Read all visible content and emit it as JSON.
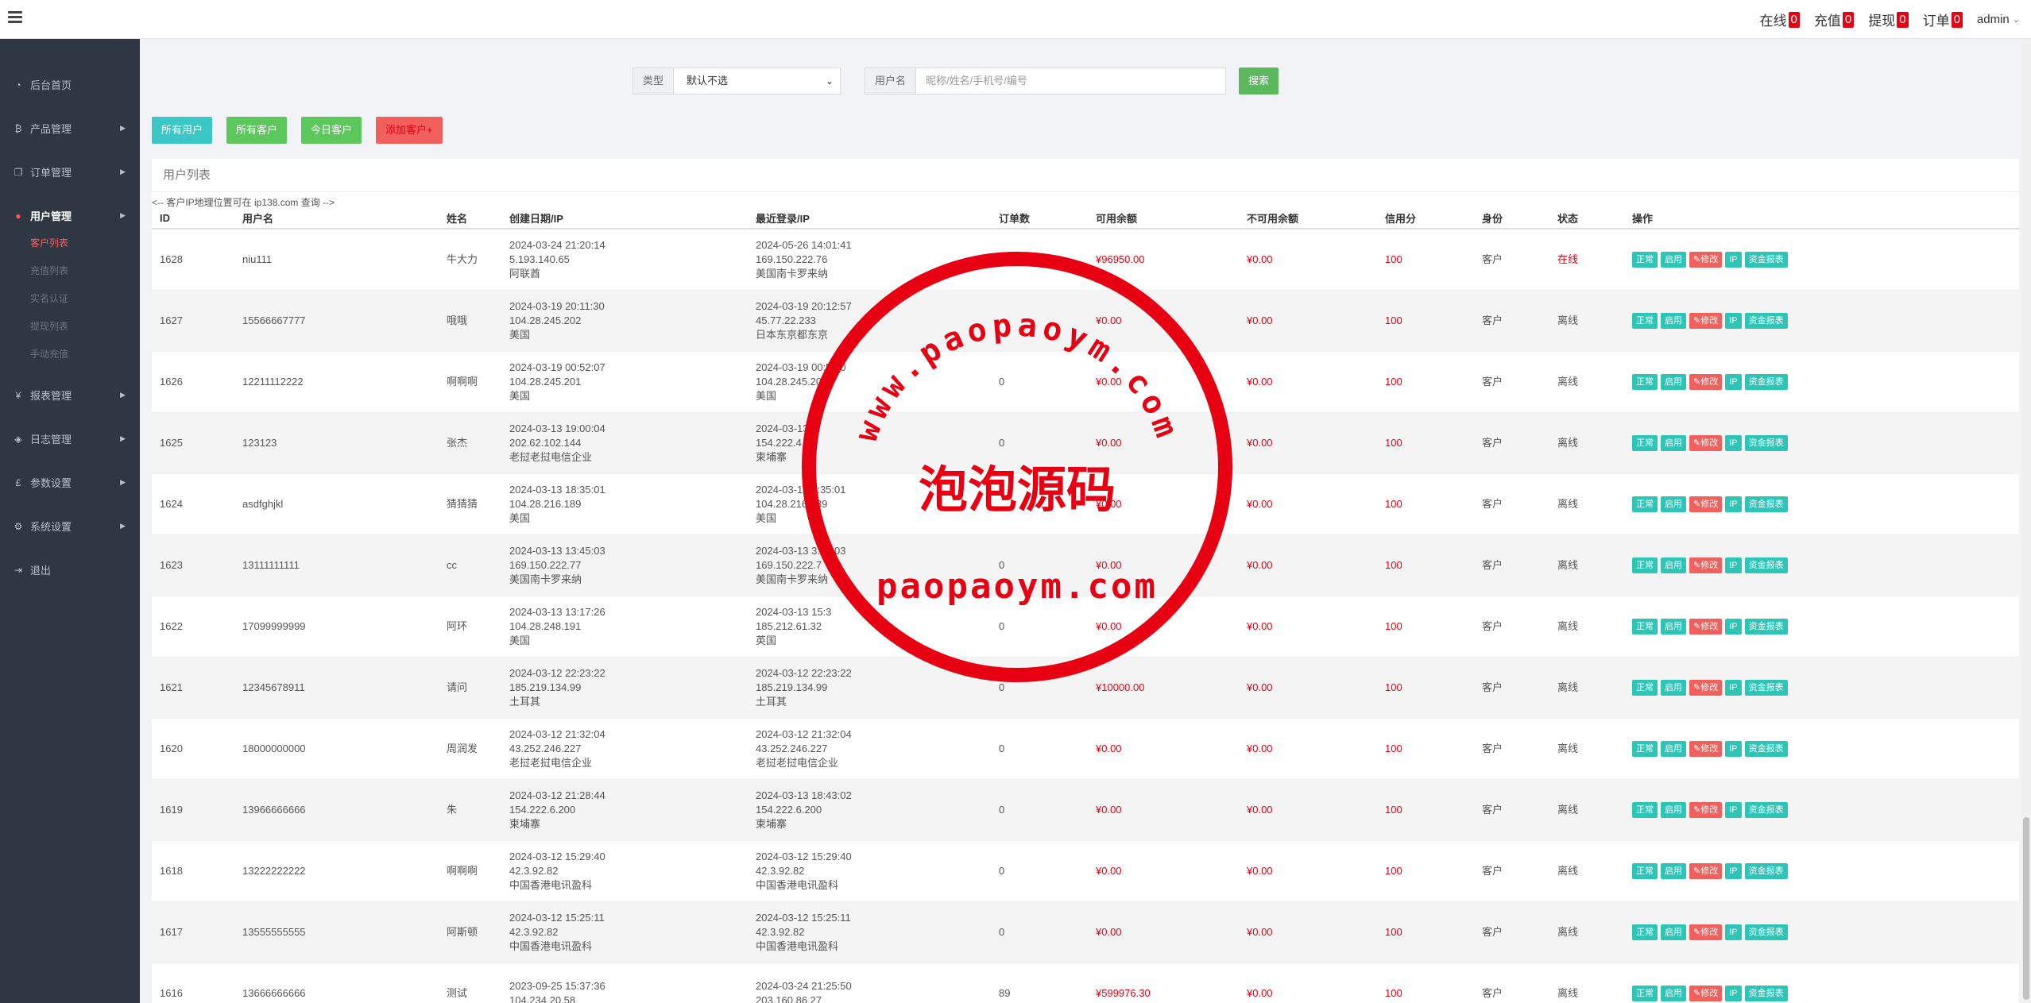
{
  "topbar": {
    "nav": [
      {
        "label": "在线",
        "badge": "0"
      },
      {
        "label": "充值",
        "badge": "0"
      },
      {
        "label": "提现",
        "badge": "0"
      },
      {
        "label": "订单",
        "badge": "0"
      }
    ],
    "user": "admin"
  },
  "sidebar": {
    "items": [
      {
        "label": "后台首页",
        "icon": "dashboard-icon"
      },
      {
        "label": "产品管理",
        "icon": "bitcoin-icon"
      },
      {
        "label": "订单管理",
        "icon": "copy-icon"
      },
      {
        "label": "用户管理",
        "icon": "user-icon"
      },
      {
        "label": "报表管理",
        "icon": "yen-icon"
      },
      {
        "label": "日志管理",
        "icon": "tag-icon"
      },
      {
        "label": "参数设置",
        "icon": "pound-icon"
      },
      {
        "label": "系统设置",
        "icon": "gears-icon"
      },
      {
        "label": "退出",
        "icon": "sign-out-icon"
      }
    ],
    "submenu": [
      "客户列表",
      "充值列表",
      "实名认证",
      "提现列表",
      "手动充值"
    ]
  },
  "search": {
    "type_label": "类型",
    "type_value": "默认不选",
    "user_label": "用户名",
    "user_placeholder": "昵称/姓名/手机号/编号",
    "search_btn": "搜索"
  },
  "filters": {
    "all_users": "所有用户",
    "all_customers": "所有客户",
    "today_customers": "今日客户",
    "add_customer": "添加客户+"
  },
  "panel": {
    "title": "用户列表",
    "comment": "<-- 客户IP地理位置可在 ip138.com 查询 -->"
  },
  "table": {
    "headers": [
      "ID",
      "用户名",
      "姓名",
      "创建日期/IP",
      "最近登录/IP",
      "订单数",
      "可用余额",
      "不可用余额",
      "信用分",
      "身份",
      "状态",
      "操作"
    ],
    "ops": [
      "正常",
      "启用",
      "✎修改",
      "IP",
      "资金报表"
    ],
    "rows": [
      {
        "id": "1628",
        "username": "niu111",
        "name": "牛大力",
        "created_date": "2024-03-24 21:20:14",
        "created_ip": "5.193.140.65",
        "created_loc": "阿联酋",
        "login_date": "2024-05-26 14:01:41",
        "login_ip": "169.150.222.76",
        "login_loc": "美国南卡罗来纳",
        "orders": "16",
        "balance": "¥96950.00",
        "frozen": "¥0.00",
        "credit": "100",
        "role": "客户",
        "status": "在线"
      },
      {
        "id": "1627",
        "username": "15566667777",
        "name": "哦哦",
        "created_date": "2024-03-19 20:11:30",
        "created_ip": "104.28.245.202",
        "created_loc": "美国",
        "login_date": "2024-03-19 20:12:57",
        "login_ip": "45.77.22.233",
        "login_loc": "日本东京都东京",
        "orders": "",
        "balance": "¥0.00",
        "frozen": "¥0.00",
        "credit": "100",
        "role": "客户",
        "status": "离线"
      },
      {
        "id": "1626",
        "username": "12211112222",
        "name": "啊啊啊",
        "created_date": "2024-03-19 00:52:07",
        "created_ip": "104.28.245.201",
        "created_loc": "美国",
        "login_date": "2024-03-19 00:52:0",
        "login_ip": "104.28.245.201",
        "login_loc": "美国",
        "orders": "0",
        "balance": "¥0.00",
        "frozen": "¥0.00",
        "credit": "100",
        "role": "客户",
        "status": "离线"
      },
      {
        "id": "1625",
        "username": "123123",
        "name": "张杰",
        "created_date": "2024-03-13 19:00:04",
        "created_ip": "202.62.102.144",
        "created_loc": "老挝老挝电信企业",
        "login_date": "2024-03-13",
        "login_ip": "154.222.4.1",
        "login_loc": "柬埔寨",
        "orders": "0",
        "balance": "¥0.00",
        "frozen": "¥0.00",
        "credit": "100",
        "role": "客户",
        "status": "离线"
      },
      {
        "id": "1624",
        "username": "asdfghjkl",
        "name": "猜猜猜",
        "created_date": "2024-03-13 18:35:01",
        "created_ip": "104.28.216.189",
        "created_loc": "美国",
        "login_date": "2024-03-1  18:35:01",
        "login_ip": "104.28.216.189",
        "login_loc": "美国",
        "orders": "",
        "balance": "¥0.00",
        "frozen": "¥0.00",
        "credit": "100",
        "role": "客户",
        "status": "离线"
      },
      {
        "id": "1623",
        "username": "13111111111",
        "name": "cc",
        "created_date": "2024-03-13 13:45:03",
        "created_ip": "169.150.222.77",
        "created_loc": "美国南卡罗来纳",
        "login_date": "2024-03-13  3:45:03",
        "login_ip": "169.150.222.7",
        "login_loc": "美国南卡罗来纳",
        "orders": "0",
        "balance": "¥0.00",
        "frozen": "¥0.00",
        "credit": "100",
        "role": "客户",
        "status": "离线"
      },
      {
        "id": "1622",
        "username": "17099999999",
        "name": "阿环",
        "created_date": "2024-03-13 13:17:26",
        "created_ip": "104.28.248.191",
        "created_loc": "美国",
        "login_date": "2024-03-13 15:3",
        "login_ip": "185.212.61.32",
        "login_loc": "英国",
        "orders": "0",
        "balance": "¥0.00",
        "frozen": "¥0.00",
        "credit": "100",
        "role": "客户",
        "status": "离线"
      },
      {
        "id": "1621",
        "username": "12345678911",
        "name": "请问",
        "created_date": "2024-03-12 22:23:22",
        "created_ip": "185.219.134.99",
        "created_loc": "土耳其",
        "login_date": "2024-03-12 22:23:22",
        "login_ip": "185.219.134.99",
        "login_loc": "土耳其",
        "orders": "0",
        "balance": "¥10000.00",
        "frozen": "¥0.00",
        "credit": "100",
        "role": "客户",
        "status": "离线"
      },
      {
        "id": "1620",
        "username": "18000000000",
        "name": "周润发",
        "created_date": "2024-03-12 21:32:04",
        "created_ip": "43.252.246.227",
        "created_loc": "老挝老挝电信企业",
        "login_date": "2024-03-12 21:32:04",
        "login_ip": "43.252.246.227",
        "login_loc": "老挝老挝电信企业",
        "orders": "0",
        "balance": "¥0.00",
        "frozen": "¥0.00",
        "credit": "100",
        "role": "客户",
        "status": "离线"
      },
      {
        "id": "1619",
        "username": "13966666666",
        "name": "朱",
        "created_date": "2024-03-12 21:28:44",
        "created_ip": "154.222.6.200",
        "created_loc": "柬埔寨",
        "login_date": "2024-03-13 18:43:02",
        "login_ip": "154.222.6.200",
        "login_loc": "柬埔寨",
        "orders": "0",
        "balance": "¥0.00",
        "frozen": "¥0.00",
        "credit": "100",
        "role": "客户",
        "status": "离线"
      },
      {
        "id": "1618",
        "username": "13222222222",
        "name": "啊啊啊",
        "created_date": "2024-03-12 15:29:40",
        "created_ip": "42.3.92.82",
        "created_loc": "中国香港电讯盈科",
        "login_date": "2024-03-12 15:29:40",
        "login_ip": "42.3.92.82",
        "login_loc": "中国香港电讯盈科",
        "orders": "0",
        "balance": "¥0.00",
        "frozen": "¥0.00",
        "credit": "100",
        "role": "客户",
        "status": "离线"
      },
      {
        "id": "1617",
        "username": "13555555555",
        "name": "阿斯顿",
        "created_date": "2024-03-12 15:25:11",
        "created_ip": "42.3.92.82",
        "created_loc": "中国香港电讯盈科",
        "login_date": "2024-03-12 15:25:11",
        "login_ip": "42.3.92.82",
        "login_loc": "中国香港电讯盈科",
        "orders": "0",
        "balance": "¥0.00",
        "frozen": "¥0.00",
        "credit": "100",
        "role": "客户",
        "status": "离线"
      },
      {
        "id": "1616",
        "username": "13666666666",
        "name": "测试",
        "created_date": "2023-09-25 15:37:36",
        "created_ip": "104.234.20.58",
        "created_loc": "",
        "login_date": "2024-03-24 21:25:50",
        "login_ip": "203.160.86.27",
        "login_loc": "",
        "orders": "89",
        "balance": "¥599976.30",
        "frozen": "¥0.00",
        "credit": "100",
        "role": "客户",
        "status": "离线"
      }
    ]
  },
  "watermark": {
    "url": "www.paopaoym.com",
    "title": "泡泡源码",
    "domain": "paopaoym.com"
  },
  "colors": {
    "sidebar_bg": "#2f3742",
    "accent_red": "#e60012",
    "teal": "#2ec4b6",
    "green": "#5cb85c"
  }
}
